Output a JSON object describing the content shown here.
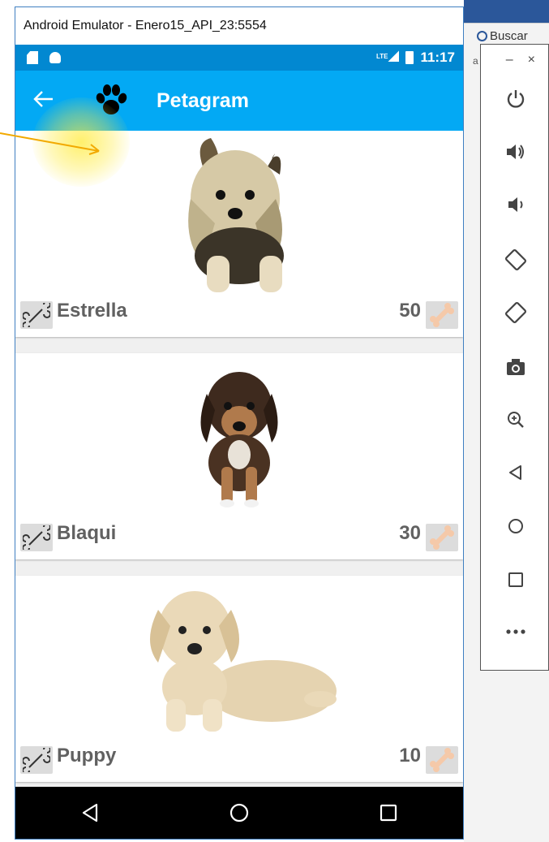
{
  "window": {
    "title": "Android Emulator - Enero15_API_23:5554"
  },
  "background": {
    "search_label": "Buscar",
    "tiny_char": "a"
  },
  "statusbar": {
    "network": "LTE",
    "time": "11:17"
  },
  "appbar": {
    "title": "Petagram"
  },
  "pets": [
    {
      "name": "Estrella",
      "likes": "50"
    },
    {
      "name": "Blaqui",
      "likes": "30"
    },
    {
      "name": "Puppy",
      "likes": "10"
    }
  ],
  "side_toolbar": {
    "minimize": "–",
    "close": "×"
  },
  "colors": {
    "statusbar": "#0288d1",
    "appbar": "#03a9f4",
    "bone_fill": "#f5c9a9"
  }
}
